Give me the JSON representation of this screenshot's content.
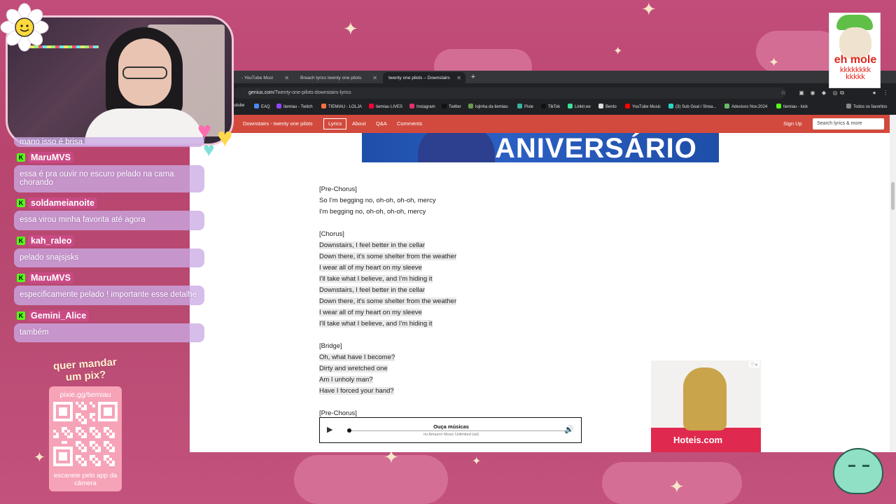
{
  "chat": {
    "top_cut_text": "mano isso é brisa",
    "messages": [
      {
        "user": "MaruMVS",
        "text": "essa é pra ouvir no escuro pelado na cama chorando"
      },
      {
        "user": "soldameianoite",
        "text": "essa virou minha favorita até agora"
      },
      {
        "user": "kah_raleo",
        "text": "pelado snajsjsks"
      },
      {
        "user": "MaruMVS",
        "text": "especificamente pelado ! importante esse detalhe"
      },
      {
        "user": "Gemini_Alice",
        "text": "também"
      }
    ]
  },
  "pix": {
    "title": "quer mandar um pix?",
    "url": "pixie.gg/tiemiau",
    "footer": "escaneie pelo app da câmera"
  },
  "overlay": {
    "dog_text": "eh mole",
    "dog_laugh": "kkkkkkkk kkkkk"
  },
  "browser": {
    "tabs": [
      {
        "label": "- YouTube Musi",
        "active": false
      },
      {
        "label": "Breach lyrics twenty one pilots",
        "active": false
      },
      {
        "label": "twenty one pilots – Downstairs",
        "active": true
      }
    ],
    "url_host": "genius.com",
    "url_path": "/Twenty-one-pilots-downstairs-lyrics",
    "bookmarks": [
      "outube",
      "EAQ",
      "tiemiau - Twitch",
      "TIEMIAU - LOLJA",
      "tiemiau LIVES",
      "Instagram",
      "Twitter",
      "lojinha da tiemiau",
      "Pixie",
      "TikTok",
      "Linktr.ee",
      "Bento",
      "YouTube Music",
      "(3) Sub Goal / Strea...",
      "Adesivos Nov.2024",
      "tiemiau - kick"
    ],
    "bookmarks_all": "Todos os favoritos"
  },
  "genius": {
    "song_title": "Downstairs - twenty one pilots",
    "nav_lyrics": "Lyrics",
    "nav_about": "About",
    "nav_qa": "Q&A",
    "nav_comments": "Comments",
    "sign_up": "Sign Up",
    "search_placeholder": "Search lyrics & more",
    "banner_text": "ANIVERSÁRIO"
  },
  "lyrics": [
    {
      "text": "[Pre-Chorus]",
      "hl": false
    },
    {
      "text": "So I'm begging no, oh-oh, oh-oh, mercy",
      "hl": false
    },
    {
      "text": "I'm begging no, oh-oh, oh-oh, mercy",
      "hl": false
    },
    {
      "text": "",
      "hl": false
    },
    {
      "text": "[Chorus]",
      "hl": false
    },
    {
      "text": "Downstairs, I feel better in the cellar",
      "hl": true
    },
    {
      "text": "Down there, it's some shelter from the weather",
      "hl": true
    },
    {
      "text": "I wear all of my heart on my sleeve",
      "hl": true
    },
    {
      "text": "I'll take what I believe, and I'm hiding it",
      "hl": true
    },
    {
      "text": "Downstairs, I feel better in the cellar",
      "hl": true
    },
    {
      "text": "Down there, it's some shelter from the weather",
      "hl": true
    },
    {
      "text": "I wear all of my heart on my sleeve",
      "hl": true
    },
    {
      "text": "I'll take what I believe, and I'm hiding it",
      "hl": true
    },
    {
      "text": "",
      "hl": false
    },
    {
      "text": "[Bridge]",
      "hl": false
    },
    {
      "text": "Oh, what have I become?",
      "hl": true
    },
    {
      "text": "Dirty and wretched one",
      "hl": true
    },
    {
      "text": "Am I unholy man?",
      "hl": true
    },
    {
      "text": "Have I forced your hand?",
      "hl": true
    },
    {
      "text": "",
      "hl": false
    },
    {
      "text": "[Pre-Chorus]",
      "hl": false
    }
  ],
  "player": {
    "title": "Ouça músicas",
    "subtitle": "no Amazon Music Unlimited (ad)"
  },
  "ad": {
    "brand": "Hoteis.com"
  },
  "colors": {
    "genius_red": "#d14a3d",
    "kick_green": "#53fc18",
    "username_pink": "#c94a84",
    "bubble_lilac": "#caaae4"
  }
}
